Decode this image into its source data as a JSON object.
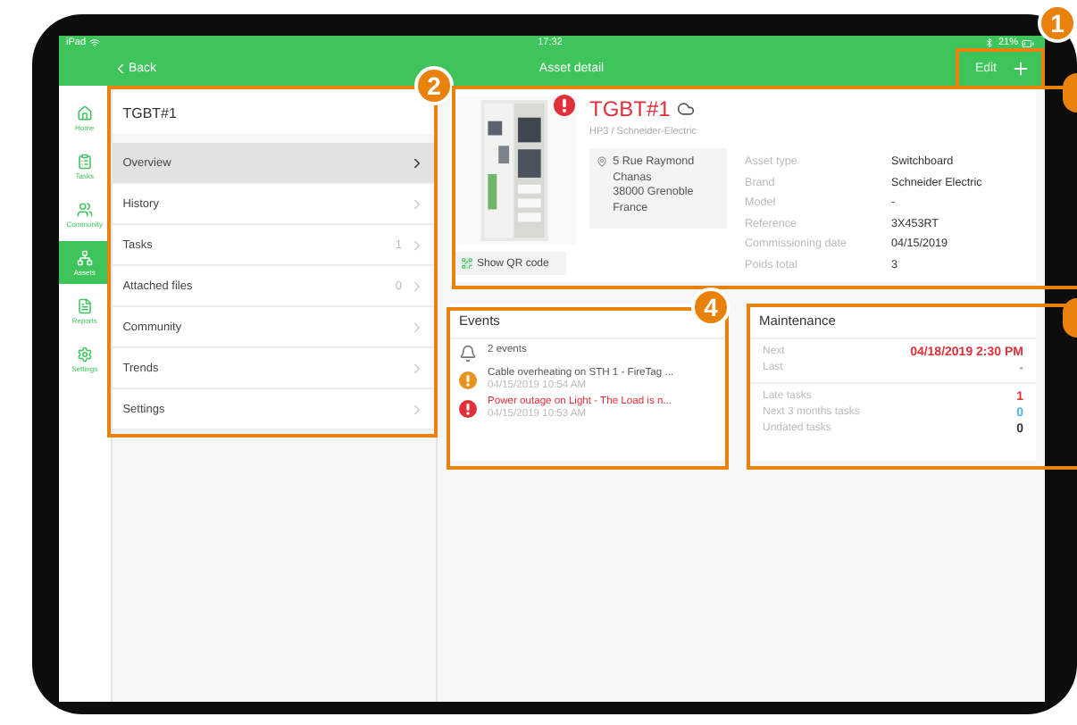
{
  "status_bar": {
    "device": "iPad",
    "time": "17:32",
    "battery": "21%"
  },
  "nav_bar": {
    "back": "Back",
    "title": "Asset detail",
    "edit": "Edit"
  },
  "tab_bar": [
    {
      "label": "Home",
      "selected": false
    },
    {
      "label": "Tasks",
      "selected": false
    },
    {
      "label": "Community",
      "selected": false
    },
    {
      "label": "Assets",
      "selected": true
    },
    {
      "label": "Reports",
      "selected": false
    },
    {
      "label": "Settings",
      "selected": false
    }
  ],
  "menu": {
    "title": "TGBT#1",
    "items": [
      {
        "label": "Overview",
        "selected": true
      },
      {
        "label": "History",
        "selected": false
      },
      {
        "label": "Tasks",
        "count": "1",
        "selected": false
      },
      {
        "label": "Attached files",
        "count": "0",
        "selected": false
      },
      {
        "label": "Community",
        "selected": false
      },
      {
        "label": "Trends",
        "selected": false
      },
      {
        "label": "Settings",
        "selected": false
      }
    ]
  },
  "asset": {
    "name": "TGBT#1",
    "alert": true,
    "subtitle": "HP3 / Schneider-Electric",
    "address": [
      "5 Rue Raymond Chanas",
      "38000 Grenoble",
      "France"
    ],
    "qr_button": "Show QR code",
    "properties": [
      {
        "label": "Asset type",
        "value": "Switchboard"
      },
      {
        "label": "Brand",
        "value": "Schneider Electric"
      },
      {
        "label": "Model",
        "value": "-"
      },
      {
        "label": "Reference",
        "value": "3X453RT"
      },
      {
        "label": "Commissioning date",
        "value": "04/15/2019"
      },
      {
        "label": "Poids total",
        "value": "3"
      }
    ]
  },
  "events": {
    "title": "Events",
    "summary": "2 events",
    "items": [
      {
        "text": "Cable overheating on STH 1 - FireTag ...",
        "time": "04/15/2019 10:54 AM",
        "kind": "warning"
      },
      {
        "text": "Power outage on Light - The Load is n...",
        "time": "04/15/2019 10:53 AM",
        "kind": "critical"
      }
    ]
  },
  "maintenance": {
    "title": "Maintenance",
    "dates": [
      {
        "label": "Next",
        "value": "04/18/2019 2:30 PM",
        "color": "#e0303a"
      },
      {
        "label": "Last",
        "value": "-",
        "color": "#999999"
      }
    ],
    "tasks": [
      {
        "label": "Late tasks",
        "value": "1",
        "color": "#e0303a"
      },
      {
        "label": "Next 3 months tasks",
        "value": "0",
        "color": "#4fb3e8"
      },
      {
        "label": "Undated tasks",
        "value": "0",
        "color": "#333333"
      }
    ]
  },
  "callouts": [
    {
      "kind": "numbered",
      "number": "1"
    },
    {
      "kind": "numbered",
      "number": "2"
    },
    {
      "kind": "partial"
    },
    {
      "kind": "numbered",
      "number": "4"
    },
    {
      "kind": "partial"
    }
  ]
}
